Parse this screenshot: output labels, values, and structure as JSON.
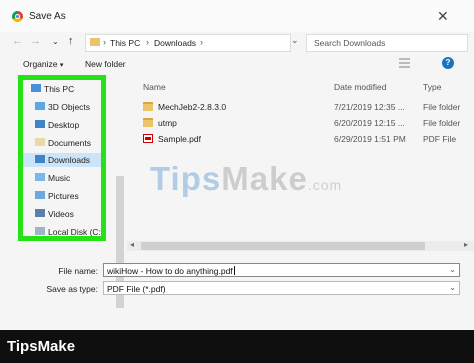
{
  "window": {
    "title": "Save As"
  },
  "address_bar": {
    "crumbs": [
      "This PC",
      "Downloads"
    ]
  },
  "search": {
    "placeholder": "Search Downloads"
  },
  "toolbar": {
    "organize": "Organize",
    "new_folder": "New folder"
  },
  "nav_pane": {
    "items": [
      {
        "label": "This PC",
        "icon": "pc-icon"
      },
      {
        "label": "3D Objects",
        "icon": "3d-objects-icon"
      },
      {
        "label": "Desktop",
        "icon": "desktop-icon"
      },
      {
        "label": "Documents",
        "icon": "documents-icon"
      },
      {
        "label": "Downloads",
        "icon": "downloads-icon",
        "selected": true
      },
      {
        "label": "Music",
        "icon": "music-icon"
      },
      {
        "label": "Pictures",
        "icon": "pictures-icon"
      },
      {
        "label": "Videos",
        "icon": "videos-icon"
      },
      {
        "label": "Local Disk (C:)",
        "icon": "disk-icon"
      }
    ],
    "highlight_color": "#25e217"
  },
  "file_list": {
    "columns": [
      "Name",
      "Date modified",
      "Type"
    ],
    "rows": [
      {
        "name": "MechJeb2-2.8.3.0",
        "date": "7/21/2019 12:35 ...",
        "type": "File folder",
        "icon": "folder-icon"
      },
      {
        "name": "utmp",
        "date": "6/20/2019 12:15 ...",
        "type": "File folder",
        "icon": "folder-icon"
      },
      {
        "name": "Sample.pdf",
        "date": "6/29/2019 1:51 PM",
        "type": "PDF File",
        "icon": "pdf-icon"
      }
    ]
  },
  "form": {
    "file_name_label": "File name:",
    "file_name_value": "wikiHow - How to do anything.pdf",
    "save_as_type_label": "Save as type:",
    "save_as_type_value": "PDF File (*.pdf)"
  },
  "watermark": {
    "tips": "Tips",
    "make": "Make",
    "com": ".com"
  },
  "brand": {
    "text": "TipsMake"
  }
}
